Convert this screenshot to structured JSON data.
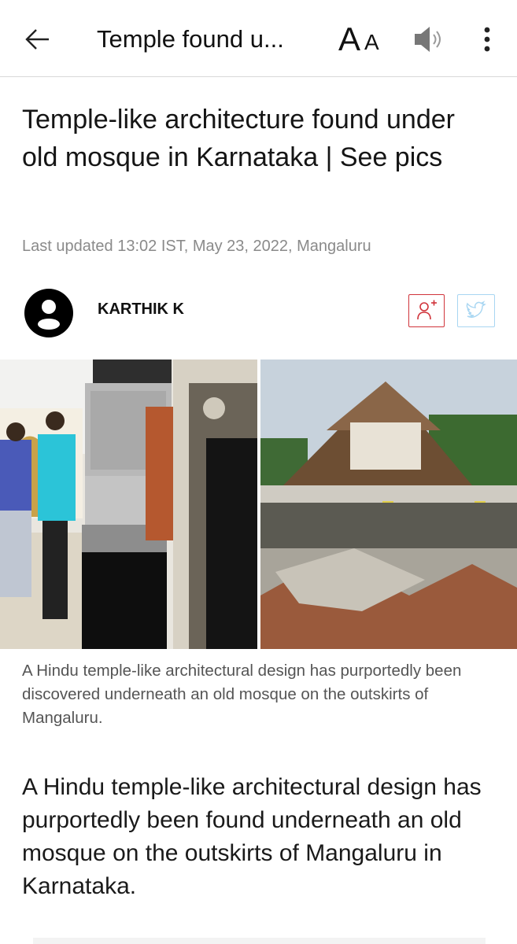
{
  "toolbar": {
    "title": "Temple found u...",
    "font_size_big": "A",
    "font_size_small": "A",
    "icons": [
      "back-arrow-icon",
      "text-size-icon",
      "speaker-icon",
      "more-vert-icon"
    ]
  },
  "article": {
    "headline": "Temple-like architecture found under old mosque in Karnataka | See pics",
    "updated": "Last updated 13:02 IST, May 23, 2022, Mangaluru",
    "author": "KARTHIK K",
    "caption": "A Hindu temple-like architectural design has purportedly been discovered underneath an old mosque on the outskirts of Mangaluru.",
    "lead": "A Hindu temple-like architectural design has purportedly been found underneath an old mosque on the outskirts of Mangaluru in Karnataka."
  },
  "colors": {
    "follow_red": "#d0343b",
    "twitter_blue": "#a8d6f2",
    "meta_gray": "#8a8a8a",
    "caption_gray": "#555555"
  }
}
